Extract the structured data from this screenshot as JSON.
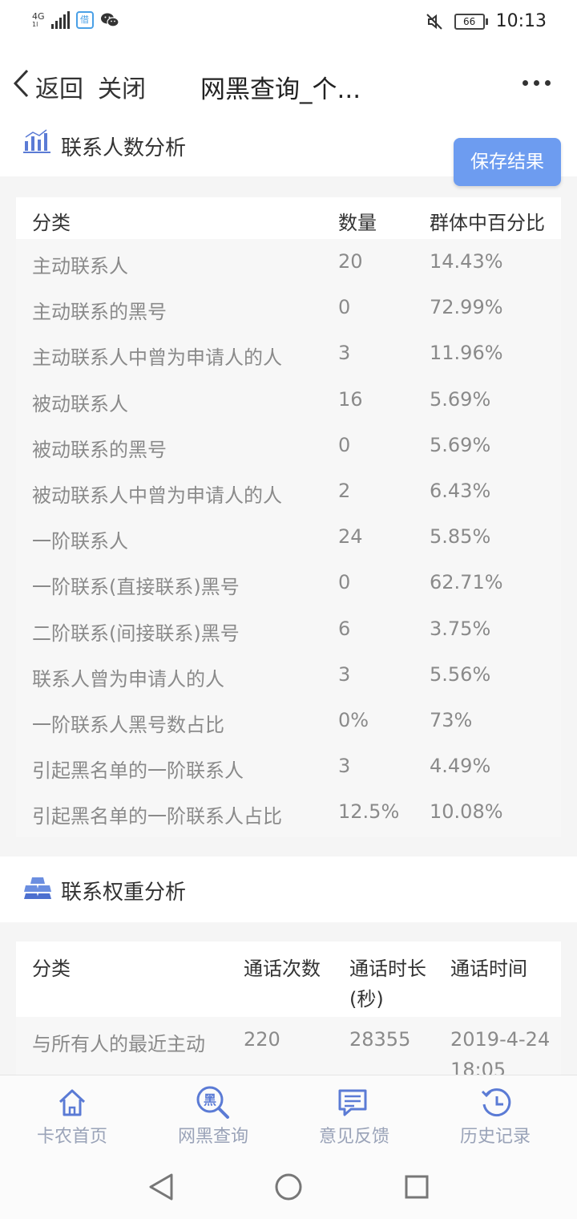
{
  "status_bar": {
    "network": "4G",
    "signal_sub": "1l",
    "app_badge": "借",
    "battery": "66",
    "time": "10:13"
  },
  "nav": {
    "back_label": "返回",
    "close_label": "关闭",
    "title": "网黑查询_个..."
  },
  "section1": {
    "title": "联系人数分析",
    "save_label": "保存结果",
    "headers": [
      "分类",
      "数量",
      "群体中百分比"
    ],
    "rows": [
      [
        "主动联系人",
        "20",
        "14.43%"
      ],
      [
        "主动联系的黑号",
        "0",
        "72.99%"
      ],
      [
        "主动联系人中曾为申请人的人",
        "3",
        "11.96%"
      ],
      [
        "被动联系人",
        "16",
        "5.69%"
      ],
      [
        "被动联系的黑号",
        "0",
        "5.69%"
      ],
      [
        "被动联系人中曾为申请人的人",
        "2",
        "6.43%"
      ],
      [
        "一阶联系人",
        "24",
        "5.85%"
      ],
      [
        "一阶联系(直接联系)黑号",
        "0",
        "62.71%"
      ],
      [
        "二阶联系(间接联系)黑号",
        "6",
        "3.75%"
      ],
      [
        "联系人曾为申请人的人",
        "3",
        "5.56%"
      ],
      [
        "一阶联系人黑号数占比",
        "0%",
        "73%"
      ],
      [
        "引起黑名单的一阶联系人",
        "3",
        "4.49%"
      ],
      [
        "引起黑名单的一阶联系人占比",
        "12.5%",
        "10.08%"
      ]
    ]
  },
  "section2": {
    "title": "联系权重分析",
    "headers": [
      "分类",
      "通话次数",
      "通话时长",
      "(秒)",
      "通话时间"
    ],
    "rows": [
      [
        "与所有人的最近主动",
        "220",
        "28355",
        "2019-4-24",
        "18:05"
      ]
    ]
  },
  "tabbar": {
    "items": [
      {
        "label": "卡农首页"
      },
      {
        "label": "网黑查询",
        "icon_text": "黑"
      },
      {
        "label": "意见反馈"
      },
      {
        "label": "历史记录"
      }
    ]
  }
}
